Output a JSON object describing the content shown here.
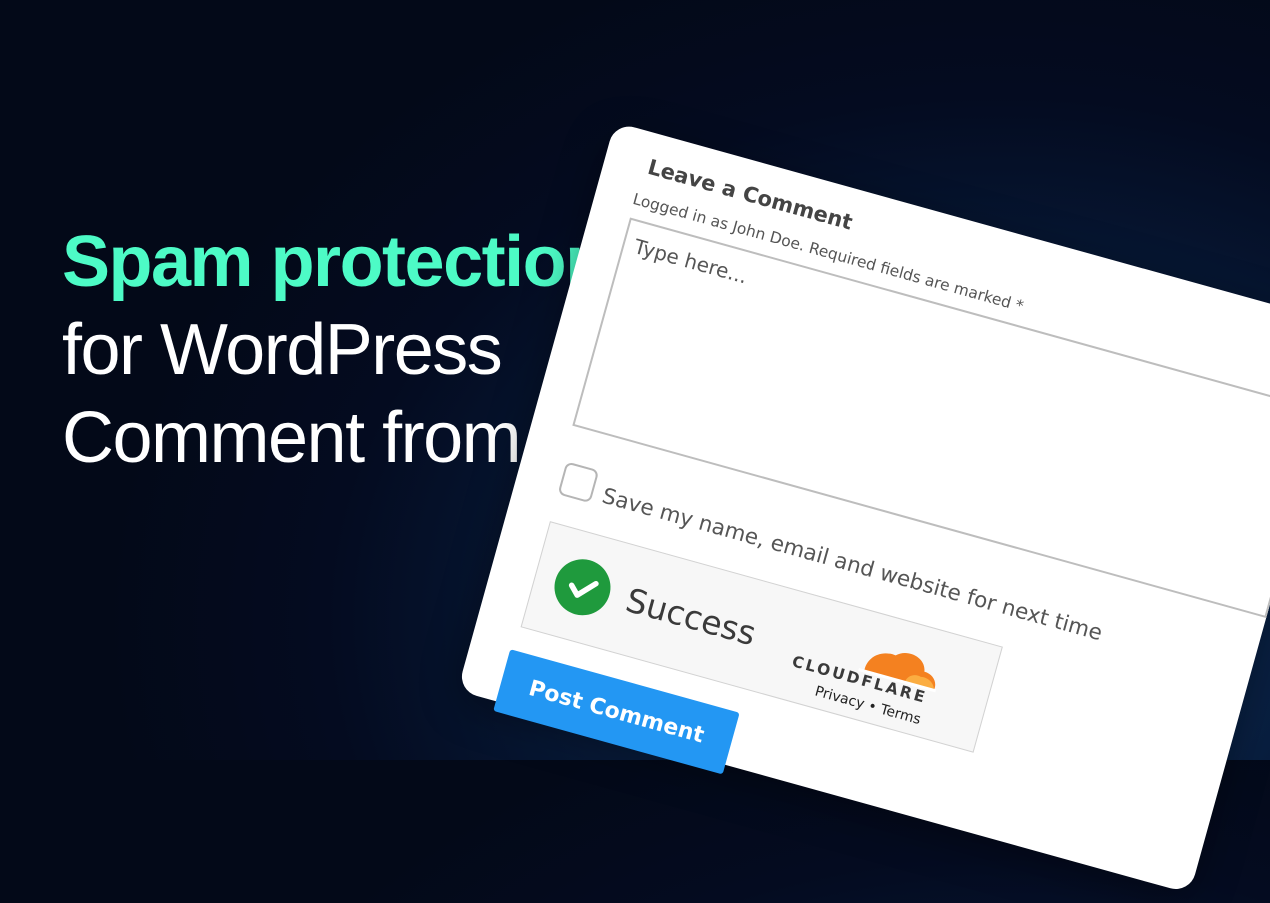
{
  "headline": {
    "line1": "Spam protection",
    "line2": "for WordPress",
    "line3": "Comment from",
    "accent_color": "#4dfbc6"
  },
  "comment_form": {
    "title": "Leave a Comment",
    "subtitle": "Logged in as John Doe. Required fields are marked *",
    "textarea_placeholder": "Type here...",
    "save_info_label": "Save my name, email and website for next time",
    "save_info_checked": false,
    "submit_label": "Post Comment",
    "submit_color": "#2397f3"
  },
  "turnstile": {
    "status_icon": "check-circle-icon",
    "status_text": "Success",
    "status_color": "#1f9a3d",
    "brand": "CLOUDFLARE",
    "brand_color": "#f48120",
    "privacy_label": "Privacy",
    "separator": "•",
    "terms_label": "Terms"
  }
}
